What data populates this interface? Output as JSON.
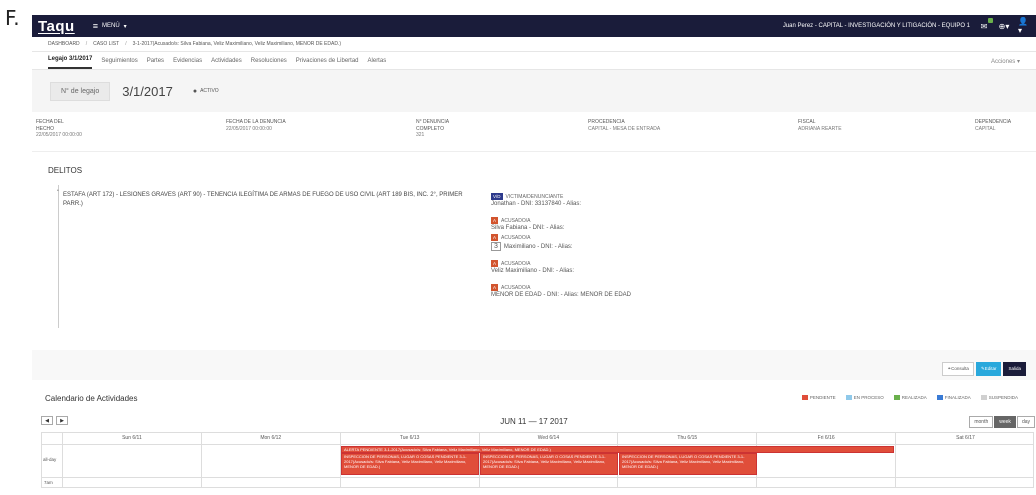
{
  "outer_label": "F.",
  "topbar": {
    "logo": "Taqu",
    "menu_label": "MENÚ",
    "user": "Juan Perez - CAPITAL - INVESTIGACIÓN Y LITIGACIÓN - EQUIPO 1"
  },
  "breadcrumb": {
    "items": [
      "DASHBOARD",
      "CASO LIST",
      "3-1-2017(Acusado/s: Silva Fabiana, Veliz Maximiliano, Veliz Maximiliano, MENOR DE EDAD.)"
    ]
  },
  "tabs": [
    "Legajo 3/1/2017",
    "Seguimientos",
    "Partes",
    "Evidencias",
    "Actividades",
    "Resoluciones",
    "Privaciones de Libertad",
    "Alertas"
  ],
  "acciones": "Acciones",
  "legajo": {
    "button": "N° de legajo",
    "number": "3/1/2017",
    "status": "ACTIVO"
  },
  "info": [
    {
      "label": "FECHA DEL HECHO",
      "value": "22/05/2017 00:00:00"
    },
    {
      "label": "FECHA DE LA DENUNCIA",
      "value": "22/05/2017 00:00:00"
    },
    {
      "label": "N° DENUNCIA COMPLETO",
      "value": "321"
    },
    {
      "label": "PROCEDENCIA",
      "value": "CAPITAL - MESA DE ENTRADA"
    },
    {
      "label": "FISCAL",
      "value": "ADRIANA REARTE"
    },
    {
      "label": "DEPENDENCIA",
      "value": "CAPITAL"
    }
  ],
  "delitos": {
    "title": "DELITOS",
    "text": "ESTAFA (ART 172) - LESIONES GRAVES (ART 90) - TENENCIA ILEGÍTIMA DE ARMAS DE FUEGO DE USO CIVIL (ART 189 BIS, INC. 2°, PRIMER PARR.)",
    "parties": [
      {
        "tag": "V/D",
        "role": "VICTIMA/DENUNCIANTE",
        "name": "Jonathan - DNI: 33137840 - Alias:"
      },
      {
        "tag": "A",
        "role": "ACUSADO/A",
        "name": "Silva Fabiana - DNI: - Alias:"
      },
      {
        "tag": "A",
        "role": "ACUSADO/A",
        "name": "Maximiliano - DNI: - Alias:",
        "tooltip": "3"
      },
      {
        "tag": "A",
        "role": "ACUSADO/A",
        "name": "Veliz Maximiliano - DNI: - Alias:"
      },
      {
        "tag": "A",
        "role": "ACUSADO/A",
        "name": "MENOR DE EDAD - DNI: - Alias: MENOR DE EDAD"
      }
    ]
  },
  "actions": {
    "consulta": "Consulta",
    "editar": "Editar",
    "salida": "Salida"
  },
  "calendar": {
    "title": "Calendario de Actividades",
    "legend": [
      {
        "label": "PENDIENTE",
        "color": "#e04e3a"
      },
      {
        "label": "EN PROCESO",
        "color": "#8fc9ea"
      },
      {
        "label": "REALIZADA",
        "color": "#6ab04c"
      },
      {
        "label": "FINALIZADA",
        "color": "#3a7bd5"
      },
      {
        "label": "SUSPENDIDA",
        "color": "#d0d0d0"
      }
    ],
    "range": "JUN 11 — 17 2017",
    "views": [
      "month",
      "week",
      "day"
    ],
    "days": [
      "Sun 6/11",
      "Mon 6/12",
      "Tue 6/13",
      "Wed 6/14",
      "Thu 6/15",
      "Fri 6/16",
      "Sat 6/17"
    ],
    "allday_label": "all-day",
    "time_label": "7am",
    "alert_event": "ALERTA PENDIENTE 3-1-2017(Acusado/s: Silva Fabiana, Veliz Maximiliano, Veliz Maximiliano, MENOR DE EDAD.)",
    "inspection_event": "INSPECCION DE PERSONAS, LUGAR O COSAS PENDIENTE 3-1-2017(Acusado/s: Silva Fabiana, Veliz Maximiliano, Veliz Maximiliano, MENOR DE EDAD.)"
  }
}
